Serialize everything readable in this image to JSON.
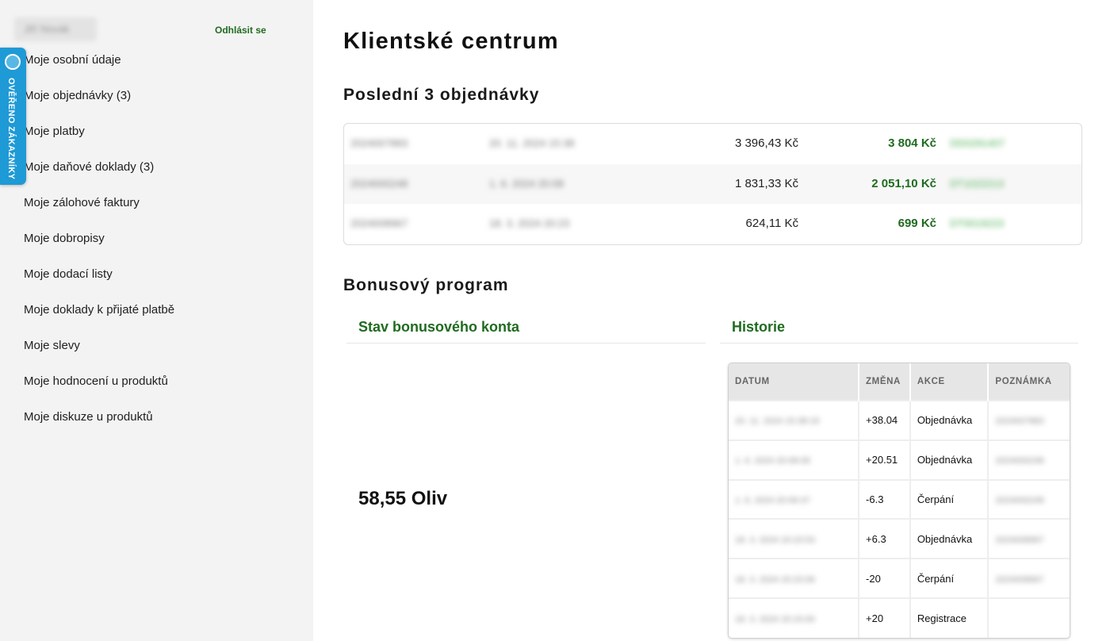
{
  "sidebar": {
    "user_name": "Jiří Novák",
    "logout_label": "Odhlásit se",
    "verified_label": "OVĚŘENO ZÁKAZNÍKY",
    "items": [
      {
        "label": "Moje osobní údaje"
      },
      {
        "label": "Moje objednávky (3)"
      },
      {
        "label": "Moje platby"
      },
      {
        "label": "Moje daňové doklady (3)"
      },
      {
        "label": "Moje zálohové faktury"
      },
      {
        "label": "Moje dobropisy"
      },
      {
        "label": "Moje dodací listy"
      },
      {
        "label": "Moje doklady k přijaté platbě"
      },
      {
        "label": "Moje slevy"
      },
      {
        "label": "Moje hodnocení u produktů"
      },
      {
        "label": "Moje diskuze u produktů"
      }
    ]
  },
  "main": {
    "title": "Klientské centrum",
    "orders_title": "Poslední 3 objednávky",
    "orders": [
      {
        "number": "2024007883",
        "date": "20. 11. 2024 15:38",
        "price_no_vat": "3 396,43 Kč",
        "total": "3 804 Kč",
        "tracking": "DD0291407"
      },
      {
        "number": "2024000248",
        "date": "1. 6. 2024 20:08",
        "price_no_vat": "1 831,33 Kč",
        "total": "2 051,10 Kč",
        "tracking": "DT1022213"
      },
      {
        "number": "2024008967",
        "date": "18. 3. 2024 20:23",
        "price_no_vat": "624,11 Kč",
        "total": "699 Kč",
        "tracking": "DT0019223"
      }
    ],
    "bonus_title": "Bonusový program",
    "bonus_state_title": "Stav bonusového konta",
    "bonus_balance": "58,55 Oliv",
    "history_title": "Historie",
    "history_columns": [
      "DATUM",
      "ZMĚNA",
      "AKCE",
      "POZNÁMKA"
    ],
    "history_rows": [
      {
        "date": "20. 11. 2024 15:38:19",
        "change": "+38.04",
        "action": "Objednávka",
        "note": "2024007883"
      },
      {
        "date": "1. 6. 2024 20:08:06",
        "change": "+20.51",
        "action": "Objednávka",
        "note": "2024000248"
      },
      {
        "date": "1. 6. 2024 20:06:47",
        "change": "-6.3",
        "action": "Čerpání",
        "note": "2024000248"
      },
      {
        "date": "18. 3. 2024 20:23:53",
        "change": "+6.3",
        "action": "Objednávka",
        "note": "2024008967"
      },
      {
        "date": "18. 3. 2024 20:23:06",
        "change": "-20",
        "action": "Čerpání",
        "note": "2024008967"
      },
      {
        "date": "18. 3. 2024 20:15:00",
        "change": "+20",
        "action": "Registrace",
        "note": ""
      }
    ]
  }
}
